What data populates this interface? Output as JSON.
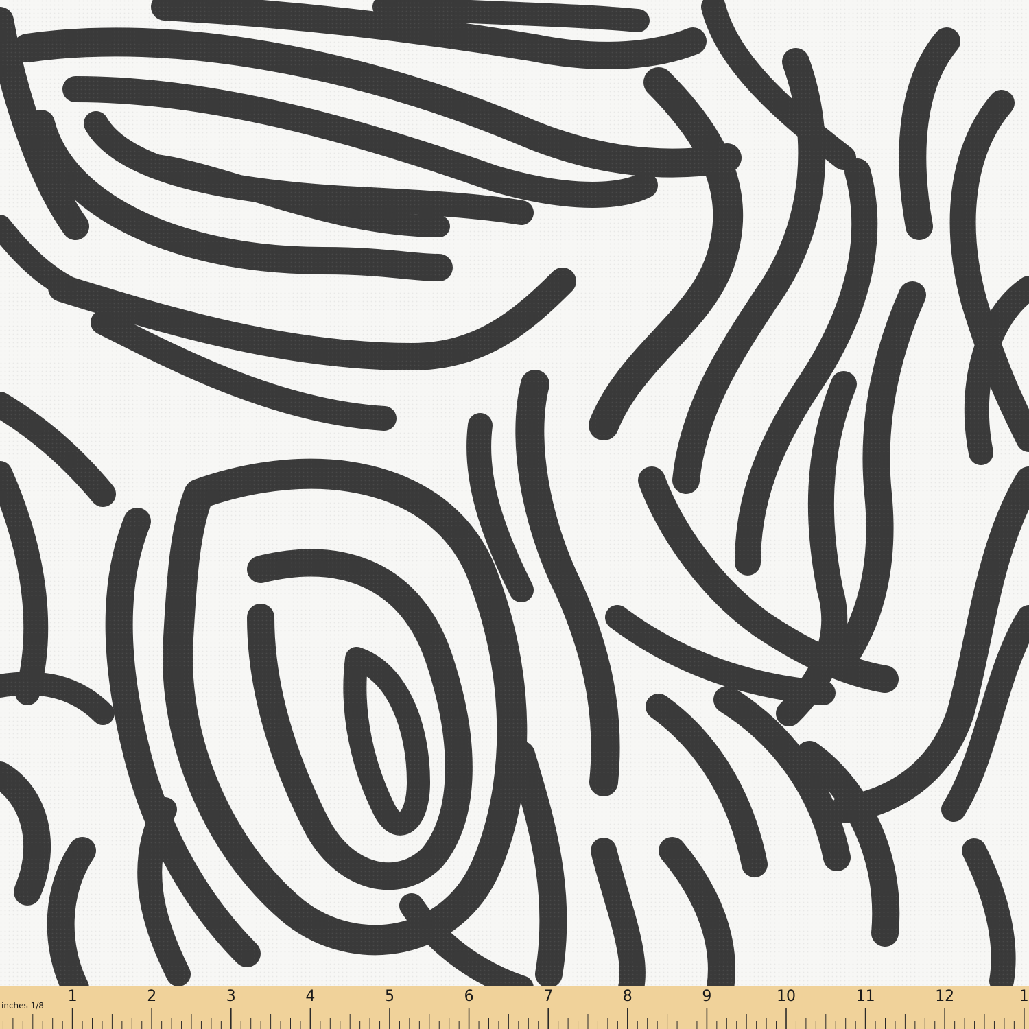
{
  "image": {
    "subject": "zebra stripe print fabric",
    "stripe_color": "#3a3a3a",
    "ground_color": "#f7f7f5"
  },
  "ruler": {
    "unit_label": "inches 1/8",
    "labels": [
      "1",
      "2",
      "3",
      "4",
      "5",
      "6",
      "7",
      "8",
      "9",
      "10",
      "11",
      "12",
      "1"
    ],
    "color": "#f0d29a",
    "tick_color": "#2a2a2a"
  }
}
